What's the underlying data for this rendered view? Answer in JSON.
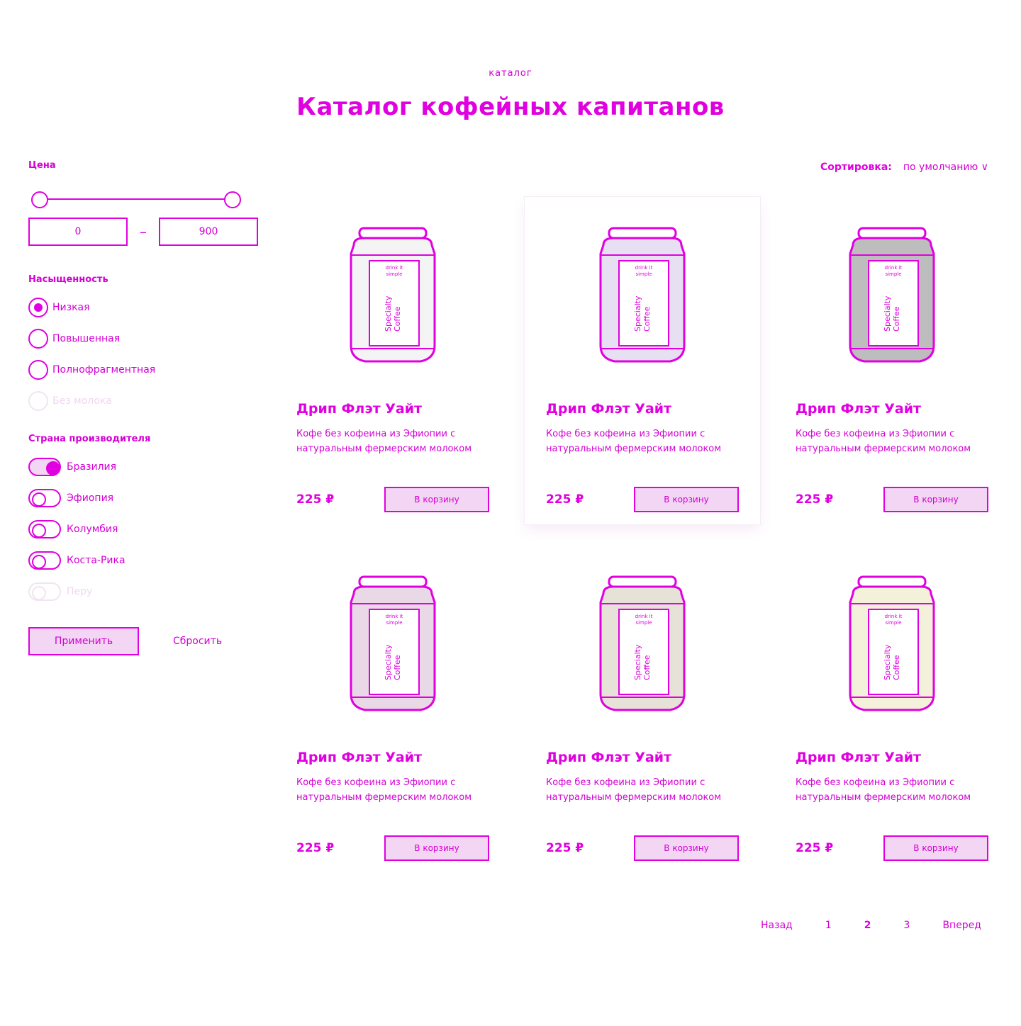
{
  "header": {
    "kicker": "каталог",
    "title": "Каталог кофейных капитанов"
  },
  "sort": {
    "label": "Сортировка:",
    "value": "по умолчанию ∨"
  },
  "filters": {
    "price": {
      "title": "Цена",
      "min": "0",
      "max": "900",
      "separator": "–",
      "range_fraction": [
        0.0,
        1.0
      ]
    },
    "saturation": {
      "title": "Насыщенность",
      "options": [
        {
          "label": "Низкая",
          "checked": true,
          "disabled": false
        },
        {
          "label": "Повышенная",
          "checked": false,
          "disabled": false
        },
        {
          "label": "Полнофрагментная",
          "checked": false,
          "disabled": false
        },
        {
          "label": "Без молока",
          "checked": false,
          "disabled": true
        }
      ]
    },
    "origin": {
      "title": "Страна производителя",
      "options": [
        {
          "label": "Бразилия",
          "on": true,
          "disabled": false
        },
        {
          "label": "Эфиопия",
          "on": false,
          "disabled": false
        },
        {
          "label": "Колумбия",
          "on": false,
          "disabled": false
        },
        {
          "label": "Коста-Рика",
          "on": false,
          "disabled": false
        },
        {
          "label": "Перу",
          "on": false,
          "disabled": true
        }
      ]
    },
    "apply_label": "Применить",
    "reset_label": "Сбросить"
  },
  "products": [
    {
      "name": "Дрип Флэт Уайт",
      "desc": "Кофе без кофеина из Эфиопии с натуральным фермерским молоком",
      "price": "225 ₽",
      "button": "В корзину",
      "can_color": "#f4f4f4",
      "featured": false
    },
    {
      "name": "Дрип Флэт Уайт",
      "desc": "Кофе без кофеина из Эфиопии с натуральным фермерским молоком",
      "price": "225 ₽",
      "button": "В корзину",
      "can_color": "#e6e0f2",
      "featured": true
    },
    {
      "name": "Дрип Флэт Уайт",
      "desc": "Кофе без кофеина из Эфиопии с натуральным фермерским молоком",
      "price": "225 ₽",
      "button": "В корзину",
      "can_color": "#bdbdbd",
      "featured": false
    },
    {
      "name": "Дрип Флэт Уайт",
      "desc": "Кофе без кофеина из Эфиопии с натуральным фермерским молоком",
      "price": "225 ₽",
      "button": "В корзину",
      "can_color": "#e9d9e6",
      "featured": false
    },
    {
      "name": "Дрип Флэт Уайт",
      "desc": "Кофе без кофеина из Эфиопии с натуральным фермерским молоком",
      "price": "225 ₽",
      "button": "В корзину",
      "can_color": "#e7e2d8",
      "featured": false
    },
    {
      "name": "Дрип Флэт Уайт",
      "desc": "Кофе без кофеина из Эфиопии с натуральным фермерским молоком",
      "price": "225 ₽",
      "button": "В корзину",
      "can_color": "#f3f1d9",
      "featured": false
    }
  ],
  "can_text": {
    "brand": "drink it\nsimple",
    "label": "Specialty\nCoffee"
  },
  "pagination": {
    "prev": "Назад",
    "pages": [
      "1",
      "2",
      "3"
    ],
    "active": "2",
    "next": "Вперед"
  },
  "colors": {
    "accent": "#e000e0",
    "accent_fill": "#f3d6f3"
  }
}
